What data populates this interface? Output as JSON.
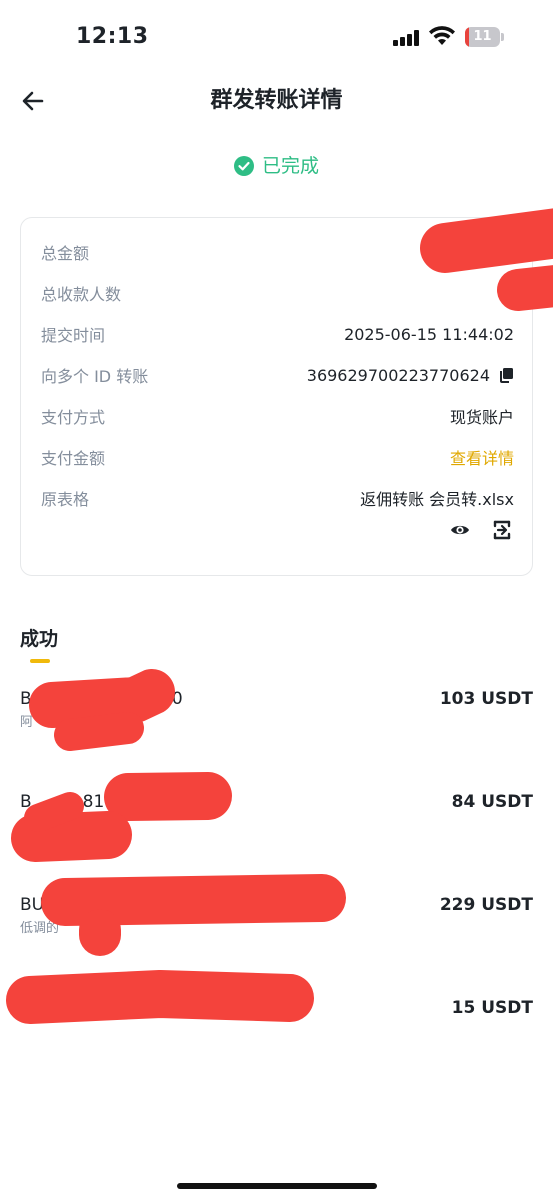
{
  "status_bar": {
    "time": "12:13",
    "battery_level": "11",
    "battery_fraction": 0.11
  },
  "header": {
    "title": "群发转账详情"
  },
  "status": {
    "text": "已完成",
    "color": "#2ebd85"
  },
  "details": {
    "total_amount_label": "总金额",
    "total_recipients_label": "总收款人数",
    "submit_time_label": "提交时间",
    "submit_time_value": "2025-06-15 11:44:02",
    "multi_id_label": "向多个 ID 转账",
    "multi_id_value": "369629700223770624",
    "payment_method_label": "支付方式",
    "payment_method_value": "现货账户",
    "payment_amount_label": "支付金额",
    "payment_amount_value": "查看详情",
    "original_sheet_label": "原表格",
    "original_sheet_value": "返佣转账 会员转.xlsx"
  },
  "tabs": {
    "success": "成功"
  },
  "transfers": [
    {
      "title": "B   12/   20",
      "subtitle": "阿",
      "amount": "103 USDT"
    },
    {
      "title": "B   81",
      "subtitle": "",
      "amount": "84 USDT"
    },
    {
      "title": "BU",
      "subtitle": "低调的",
      "amount": "229 USDT"
    },
    {
      "title": "",
      "subtitle": "",
      "amount": "15 USDT"
    }
  ],
  "colors": {
    "accent": "#f0b90b",
    "link": "#e0a800",
    "success": "#2ebd85",
    "redaction": "#f4433c"
  }
}
